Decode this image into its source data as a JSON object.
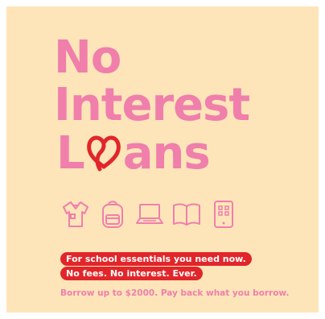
{
  "headline": {
    "line1": "No",
    "line2": "Interest",
    "line3_prefix": "L",
    "line3_suffix": "ans"
  },
  "icons": [
    "shirt-icon",
    "backpack-icon",
    "laptop-icon",
    "book-icon",
    "tablet-icon"
  ],
  "pills": {
    "line1": "For school essentials you need now.",
    "line2": "No fees. No interest. Ever."
  },
  "footer": "Borrow up to $2000. Pay back what you borrow.",
  "colors": {
    "background": "#fde5b9",
    "pink": "#f07fab",
    "red": "#e1262b",
    "white": "#ffffff"
  }
}
